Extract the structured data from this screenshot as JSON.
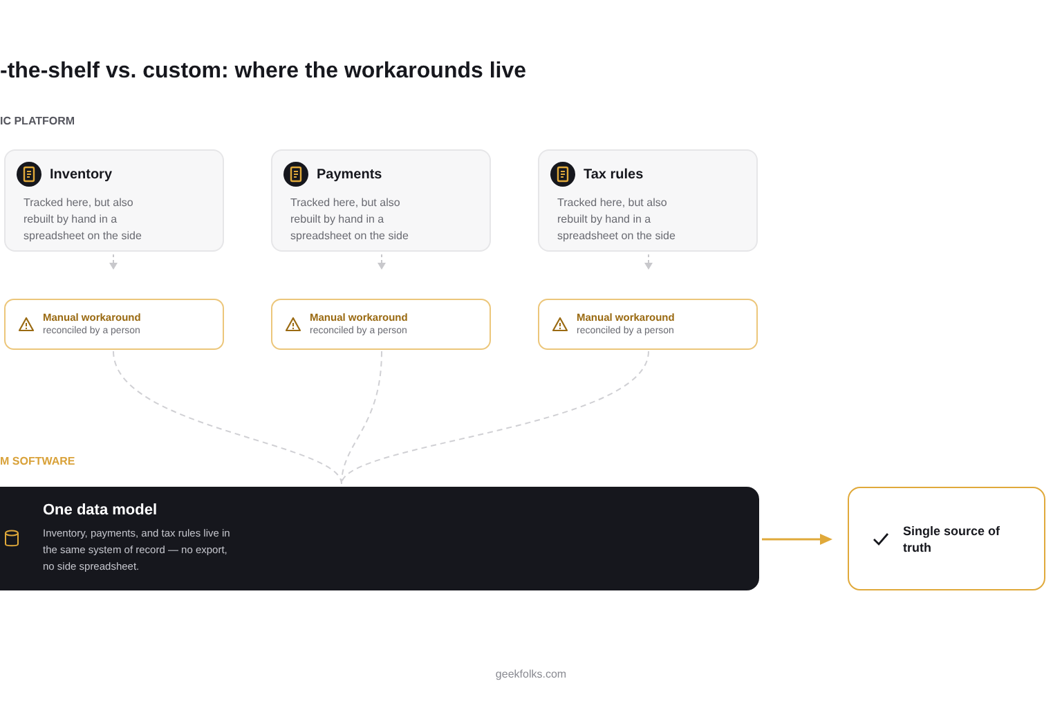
{
  "title": "-the-shelf vs. custom: where the workarounds live",
  "platform": {
    "label": "IC PLATFORM",
    "items": [
      {
        "title": "Inventory",
        "description": "Tracked here, but also rebuilt by hand in a spreadsheet on the side",
        "workaround": {
          "title": "Manual workaround",
          "subtitle": "reconciled by a person"
        }
      },
      {
        "title": "Payments",
        "description": "Tracked here, but also rebuilt by hand in a spreadsheet on the side",
        "workaround": {
          "title": "Manual workaround",
          "subtitle": "reconciled by a person"
        }
      },
      {
        "title": "Tax rules",
        "description": "Tracked here, but also rebuilt by hand in a spreadsheet on the side",
        "workaround": {
          "title": "Manual workaround",
          "subtitle": "reconciled by a person"
        }
      }
    ]
  },
  "custom": {
    "label": "M SOFTWARE",
    "model": {
      "title": "One data model",
      "description": "Inventory, payments, and tax rules live in the same system of record — no export, no side spreadsheet."
    },
    "outcome": "Single source of truth"
  },
  "footer": "geekfolks.com"
}
